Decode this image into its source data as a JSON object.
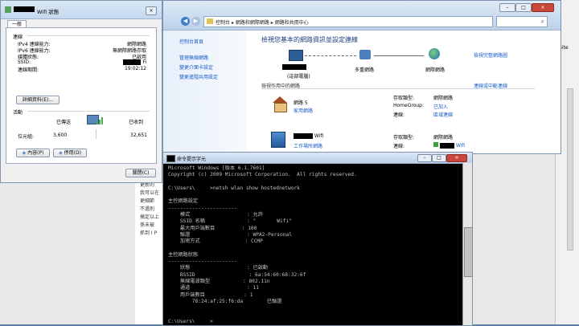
{
  "wifi_status": {
    "title_suffix": "Wifi 狀態",
    "close": "×",
    "tab": "一般",
    "conn_header": "連線",
    "rows": [
      {
        "label": "IPv4 連線能力:",
        "value": "網際網路"
      },
      {
        "label": "IPv6 連線能力:",
        "value": "無網際網路存取"
      },
      {
        "label": "媒體狀態:",
        "value": "已啟用"
      },
      {
        "label": "SSID:",
        "value": "Fi"
      },
      {
        "label": "連線期間:",
        "value": "19:02:12"
      }
    ],
    "details_button": "詳細資料(E)...",
    "activity_header": "活動",
    "sent_label": "已傳送",
    "received_label": "已收到",
    "bytes_label": "位元組:",
    "bytes_sent": "3,600",
    "bytes_received": "32,651",
    "properties_button": "內容(P)",
    "disable_button": "停用(D)",
    "close_button": "關閉(C)"
  },
  "network_center": {
    "breadcrumb": [
      "控制台",
      "網路和網際網路",
      "網路和共用中心"
    ],
    "sidebar": [
      "控制台首頁",
      "管理無線網路",
      "變更介面卡設定",
      "變更進階共用設定"
    ],
    "heading": "檢視您基本的網路資訊並設定連線",
    "full_map": "檢視完整網路圖",
    "map_nodes": [
      "(這部電腦)",
      "多重網路",
      "網際網路"
    ],
    "active_header": "檢視作用中的網路",
    "connect_link": "連線或中斷連線",
    "net1_name": "網路 5",
    "net1_type": "家用網路",
    "net1_details": [
      {
        "label": "存取類型:",
        "value": "網際網路"
      },
      {
        "label": "HomeGroup:",
        "value": "已加入"
      },
      {
        "label": "連線:",
        "value": "區域連線"
      }
    ],
    "net2_name": "Wifi",
    "net2_type": "工作場所網路",
    "net2_details": [
      {
        "label": "存取類型:",
        "value": "網際網路"
      },
      {
        "label": "連線:",
        "value": "Wifi"
      }
    ]
  },
  "cmd": {
    "title": "命令提示字元",
    "lines": [
      "Microsoft Windows [版本 6.1.7601]",
      "Copyright (c) 2009 Microsoft Corporation.  All rights reserved.",
      "",
      "C:\\Users\\     >netsh wlan show hostednetwork",
      "",
      "主控網路設定",
      "-----------------------",
      "    模式                   : 允許",
      "    SSID 名稱              : \"       Wifi\"",
      "    最大用戶端數目         : 100",
      "    驗證                   : WPA2-Personal",
      "    加密方式               : CCMP",
      "",
      "主控網路狀態",
      "-----------------------",
      "    狀態                   : 已啟動",
      "    BSSID                  : 6a:54:60:68:32:6f",
      "    無線電波類型           : 802.11n",
      "    通道                   : 11",
      "    用戶端數目             : 1",
      "        78:24:af:25:f6:da        已驗證",
      "",
      "",
      "C:\\Users\\     >"
    ]
  },
  "background_doc": {
    "lines": [
      "更新的",
      "我可以在",
      "",
      "更細節",
      "",
      "",
      "",
      "不過別",
      "搞定以上",
      "係未被",
      "抓到 I P"
    ],
    "site": "Site"
  }
}
